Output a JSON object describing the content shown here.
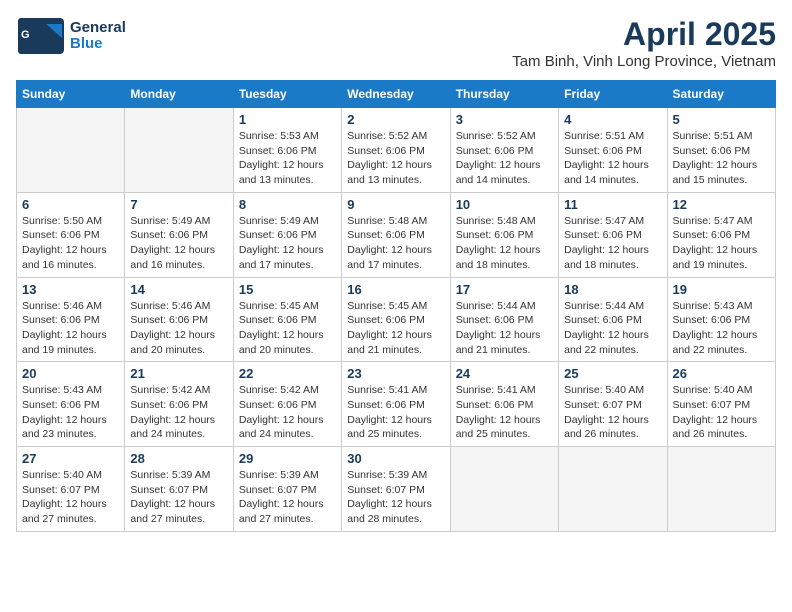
{
  "header": {
    "logo_general": "General",
    "logo_blue": "Blue",
    "title": "April 2025",
    "subtitle": "Tam Binh, Vinh Long Province, Vietnam"
  },
  "calendar": {
    "days_of_week": [
      "Sunday",
      "Monday",
      "Tuesday",
      "Wednesday",
      "Thursday",
      "Friday",
      "Saturday"
    ],
    "weeks": [
      [
        {
          "day": "",
          "sunrise": "",
          "sunset": "",
          "daylight": ""
        },
        {
          "day": "",
          "sunrise": "",
          "sunset": "",
          "daylight": ""
        },
        {
          "day": "1",
          "sunrise": "Sunrise: 5:53 AM",
          "sunset": "Sunset: 6:06 PM",
          "daylight": "Daylight: 12 hours and 13 minutes."
        },
        {
          "day": "2",
          "sunrise": "Sunrise: 5:52 AM",
          "sunset": "Sunset: 6:06 PM",
          "daylight": "Daylight: 12 hours and 13 minutes."
        },
        {
          "day": "3",
          "sunrise": "Sunrise: 5:52 AM",
          "sunset": "Sunset: 6:06 PM",
          "daylight": "Daylight: 12 hours and 14 minutes."
        },
        {
          "day": "4",
          "sunrise": "Sunrise: 5:51 AM",
          "sunset": "Sunset: 6:06 PM",
          "daylight": "Daylight: 12 hours and 14 minutes."
        },
        {
          "day": "5",
          "sunrise": "Sunrise: 5:51 AM",
          "sunset": "Sunset: 6:06 PM",
          "daylight": "Daylight: 12 hours and 15 minutes."
        }
      ],
      [
        {
          "day": "6",
          "sunrise": "Sunrise: 5:50 AM",
          "sunset": "Sunset: 6:06 PM",
          "daylight": "Daylight: 12 hours and 16 minutes."
        },
        {
          "day": "7",
          "sunrise": "Sunrise: 5:49 AM",
          "sunset": "Sunset: 6:06 PM",
          "daylight": "Daylight: 12 hours and 16 minutes."
        },
        {
          "day": "8",
          "sunrise": "Sunrise: 5:49 AM",
          "sunset": "Sunset: 6:06 PM",
          "daylight": "Daylight: 12 hours and 17 minutes."
        },
        {
          "day": "9",
          "sunrise": "Sunrise: 5:48 AM",
          "sunset": "Sunset: 6:06 PM",
          "daylight": "Daylight: 12 hours and 17 minutes."
        },
        {
          "day": "10",
          "sunrise": "Sunrise: 5:48 AM",
          "sunset": "Sunset: 6:06 PM",
          "daylight": "Daylight: 12 hours and 18 minutes."
        },
        {
          "day": "11",
          "sunrise": "Sunrise: 5:47 AM",
          "sunset": "Sunset: 6:06 PM",
          "daylight": "Daylight: 12 hours and 18 minutes."
        },
        {
          "day": "12",
          "sunrise": "Sunrise: 5:47 AM",
          "sunset": "Sunset: 6:06 PM",
          "daylight": "Daylight: 12 hours and 19 minutes."
        }
      ],
      [
        {
          "day": "13",
          "sunrise": "Sunrise: 5:46 AM",
          "sunset": "Sunset: 6:06 PM",
          "daylight": "Daylight: 12 hours and 19 minutes."
        },
        {
          "day": "14",
          "sunrise": "Sunrise: 5:46 AM",
          "sunset": "Sunset: 6:06 PM",
          "daylight": "Daylight: 12 hours and 20 minutes."
        },
        {
          "day": "15",
          "sunrise": "Sunrise: 5:45 AM",
          "sunset": "Sunset: 6:06 PM",
          "daylight": "Daylight: 12 hours and 20 minutes."
        },
        {
          "day": "16",
          "sunrise": "Sunrise: 5:45 AM",
          "sunset": "Sunset: 6:06 PM",
          "daylight": "Daylight: 12 hours and 21 minutes."
        },
        {
          "day": "17",
          "sunrise": "Sunrise: 5:44 AM",
          "sunset": "Sunset: 6:06 PM",
          "daylight": "Daylight: 12 hours and 21 minutes."
        },
        {
          "day": "18",
          "sunrise": "Sunrise: 5:44 AM",
          "sunset": "Sunset: 6:06 PM",
          "daylight": "Daylight: 12 hours and 22 minutes."
        },
        {
          "day": "19",
          "sunrise": "Sunrise: 5:43 AM",
          "sunset": "Sunset: 6:06 PM",
          "daylight": "Daylight: 12 hours and 22 minutes."
        }
      ],
      [
        {
          "day": "20",
          "sunrise": "Sunrise: 5:43 AM",
          "sunset": "Sunset: 6:06 PM",
          "daylight": "Daylight: 12 hours and 23 minutes."
        },
        {
          "day": "21",
          "sunrise": "Sunrise: 5:42 AM",
          "sunset": "Sunset: 6:06 PM",
          "daylight": "Daylight: 12 hours and 24 minutes."
        },
        {
          "day": "22",
          "sunrise": "Sunrise: 5:42 AM",
          "sunset": "Sunset: 6:06 PM",
          "daylight": "Daylight: 12 hours and 24 minutes."
        },
        {
          "day": "23",
          "sunrise": "Sunrise: 5:41 AM",
          "sunset": "Sunset: 6:06 PM",
          "daylight": "Daylight: 12 hours and 25 minutes."
        },
        {
          "day": "24",
          "sunrise": "Sunrise: 5:41 AM",
          "sunset": "Sunset: 6:06 PM",
          "daylight": "Daylight: 12 hours and 25 minutes."
        },
        {
          "day": "25",
          "sunrise": "Sunrise: 5:40 AM",
          "sunset": "Sunset: 6:07 PM",
          "daylight": "Daylight: 12 hours and 26 minutes."
        },
        {
          "day": "26",
          "sunrise": "Sunrise: 5:40 AM",
          "sunset": "Sunset: 6:07 PM",
          "daylight": "Daylight: 12 hours and 26 minutes."
        }
      ],
      [
        {
          "day": "27",
          "sunrise": "Sunrise: 5:40 AM",
          "sunset": "Sunset: 6:07 PM",
          "daylight": "Daylight: 12 hours and 27 minutes."
        },
        {
          "day": "28",
          "sunrise": "Sunrise: 5:39 AM",
          "sunset": "Sunset: 6:07 PM",
          "daylight": "Daylight: 12 hours and 27 minutes."
        },
        {
          "day": "29",
          "sunrise": "Sunrise: 5:39 AM",
          "sunset": "Sunset: 6:07 PM",
          "daylight": "Daylight: 12 hours and 27 minutes."
        },
        {
          "day": "30",
          "sunrise": "Sunrise: 5:39 AM",
          "sunset": "Sunset: 6:07 PM",
          "daylight": "Daylight: 12 hours and 28 minutes."
        },
        {
          "day": "",
          "sunrise": "",
          "sunset": "",
          "daylight": ""
        },
        {
          "day": "",
          "sunrise": "",
          "sunset": "",
          "daylight": ""
        },
        {
          "day": "",
          "sunrise": "",
          "sunset": "",
          "daylight": ""
        }
      ]
    ]
  }
}
